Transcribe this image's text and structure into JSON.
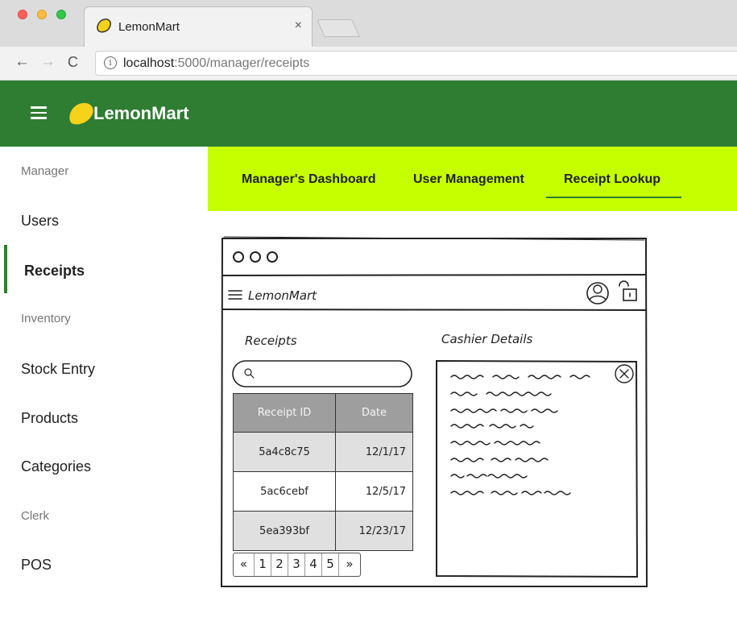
{
  "browser": {
    "tab_title": "LemonMart",
    "tab_close": "×",
    "url_host": "localhost",
    "url_rest": ":5000/manager/receipts",
    "back_glyph": "←",
    "forward_glyph": "→",
    "reload_glyph": "C",
    "info_glyph": "i"
  },
  "toolbar": {
    "app_name": "LemonMart",
    "brand_color": "#2e7d32",
    "icons": [
      "menu-icon",
      "lemon-logo-icon"
    ]
  },
  "sidebar": {
    "manager_header": "Manager",
    "users": "Users",
    "receipts": "Receipts",
    "inventory_header": "Inventory",
    "stock_entry": "Stock Entry",
    "products": "Products",
    "categories": "Categories",
    "clerk_header": "Clerk",
    "pos": "POS"
  },
  "tabs": {
    "dashboard": "Manager's Dashboard",
    "user_management": "User Management",
    "receipt_lookup": "Receipt Lookup",
    "active": "Receipt Lookup",
    "accent_color": "#c6ff00"
  },
  "mockup": {
    "brand": "LemonMart",
    "receipts_heading": "Receipts",
    "cashier_heading": "Cashier Details",
    "table_headers": {
      "id": "Receipt ID",
      "date": "Date"
    },
    "rows": [
      {
        "id": "5a4c8c75",
        "date": "12/1/17"
      },
      {
        "id": "5ac6cebf",
        "date": "12/5/17"
      },
      {
        "id": "5ea393bf",
        "date": "12/23/17"
      }
    ],
    "pager": [
      "«",
      "1",
      "2",
      "3",
      "4",
      "5",
      "»"
    ]
  }
}
